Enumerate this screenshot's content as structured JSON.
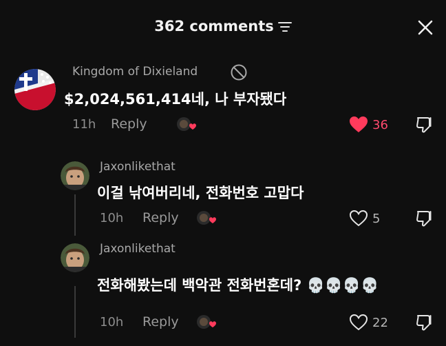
{
  "header": {
    "title": "362 comments"
  },
  "comments": [
    {
      "username": "Kingdom of Dixieland",
      "text": "$2,024,561,414네, 나 부자됐다",
      "time": "11h",
      "reply_label": "Reply",
      "likes": "36",
      "liked": true
    },
    {
      "username": "Jaxonlikethat",
      "text": "이걸 낚여버리네, 전화번호 고맙다",
      "time": "10h",
      "reply_label": "Reply",
      "likes": "5",
      "liked": false
    },
    {
      "username": "Jaxonlikethat",
      "text": "전화해봤는데 백악관 전화번혼데? 💀💀💀💀",
      "time": "10h",
      "reply_label": "Reply",
      "likes": "22",
      "liked": false
    }
  ],
  "colors": {
    "background": "#0f0f0f",
    "like_red": "#ff3b5c"
  }
}
